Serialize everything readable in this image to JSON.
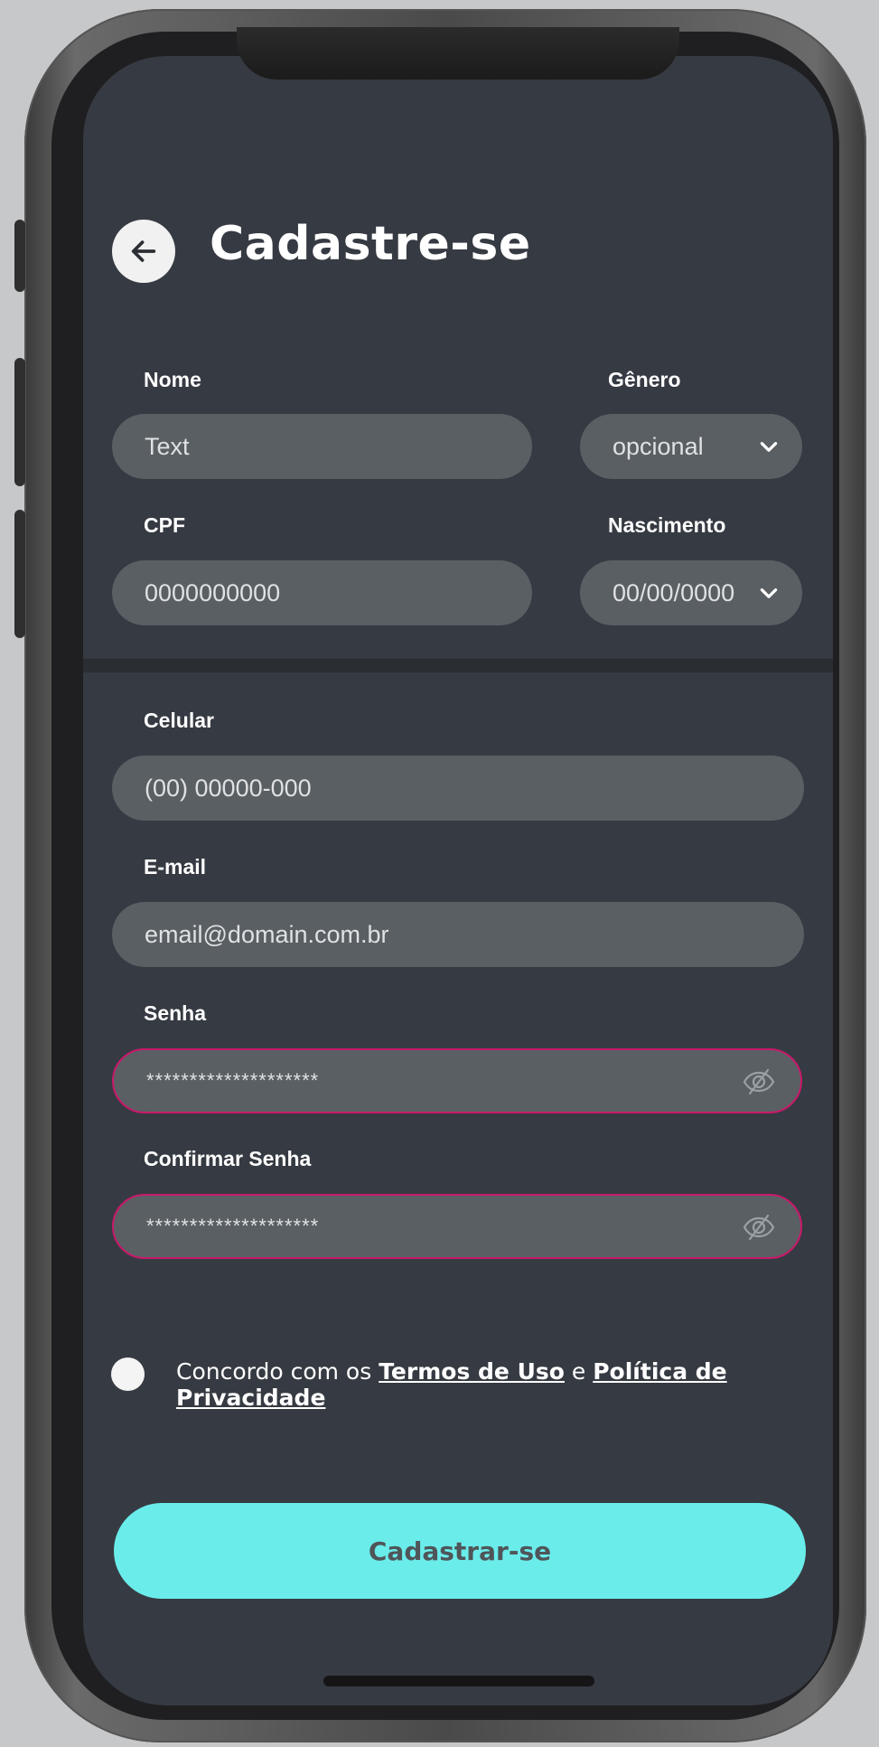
{
  "header": {
    "title": "Cadastre-se",
    "back_icon": "arrow-left-icon"
  },
  "form": {
    "nome": {
      "label": "Nome",
      "value": "Text"
    },
    "genero": {
      "label": "Gênero",
      "value": "opcional"
    },
    "cpf": {
      "label": "CPF",
      "value": "0000000000"
    },
    "nascimento": {
      "label": "Nascimento",
      "value": "00/00/0000"
    },
    "celular": {
      "label": "Celular",
      "value": "(00) 00000-000"
    },
    "email": {
      "label": "E-mail",
      "value": "email@domain.com.br"
    },
    "senha": {
      "label": "Senha",
      "value": "********************"
    },
    "confirmar_senha": {
      "label": "Confirmar Senha",
      "value": "********************"
    }
  },
  "terms": {
    "prefix": "Concordo com os ",
    "terms_link": "Termos de Uso",
    "joiner": " e ",
    "privacy_link": "Política de Privacidade"
  },
  "submit": {
    "label": "Cadastrar-se"
  },
  "colors": {
    "background": "#363a42",
    "field": "#5a5f64",
    "accent": "#6aeceb",
    "error_border": "#c8196a"
  }
}
